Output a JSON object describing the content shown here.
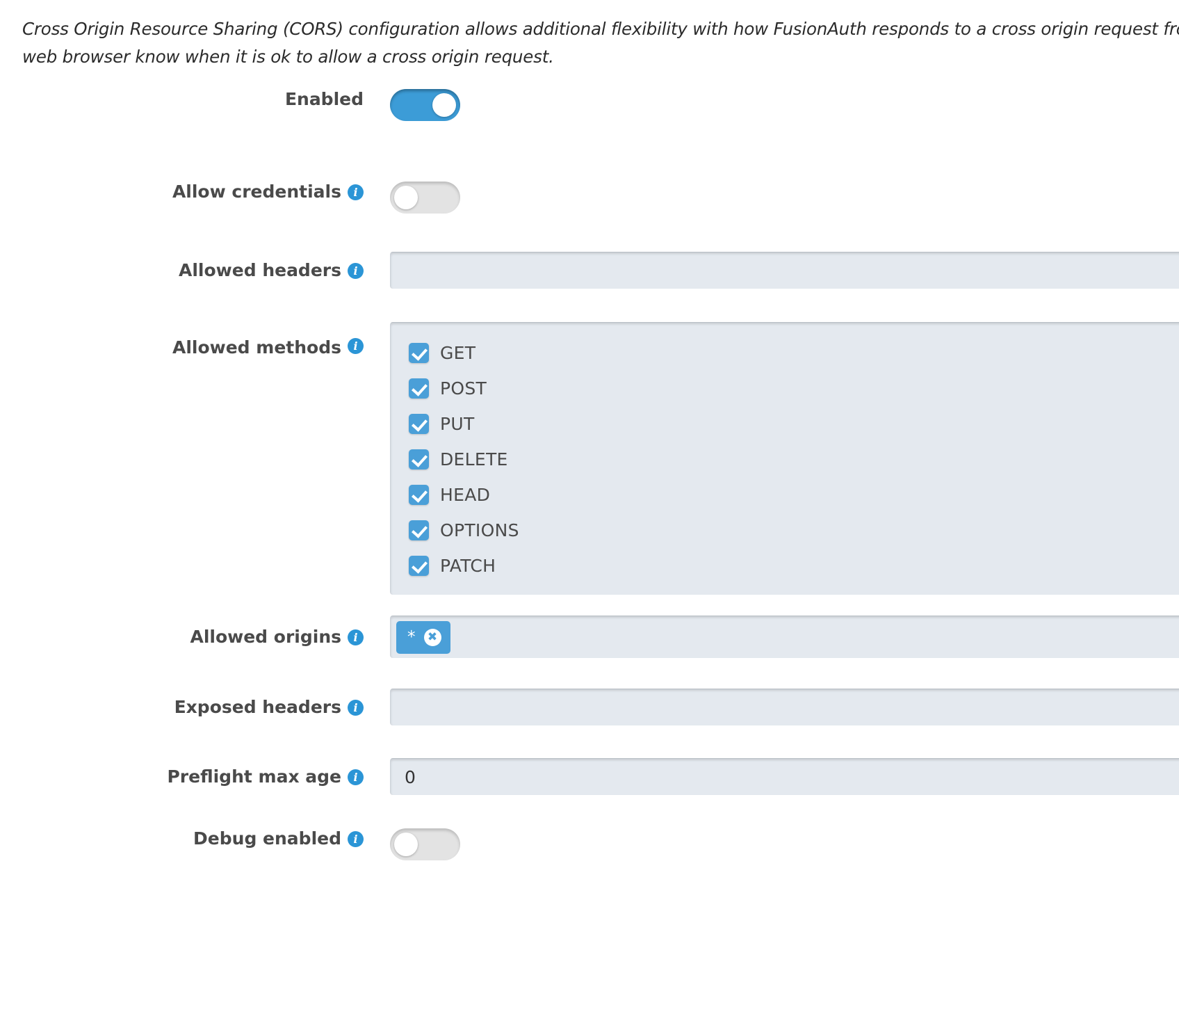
{
  "intro": {
    "line1": "Cross Origin Resource Sharing (CORS) configuration allows additional flexibility with how FusionAuth responds to a cross origin request from Ja",
    "line2": "web browser know when it is ok to allow a cross origin request."
  },
  "colors": {
    "accent_blue": "#3c9cd7",
    "checkbox_blue": "#4a9fd8",
    "info_icon_blue": "#2b95d6",
    "field_bg": "#e4e9ef",
    "label_text": "#4a4a4a",
    "toggle_off": "#e3e3e3"
  },
  "icons": {
    "info": "info-icon",
    "chip_remove": "close-circle-icon",
    "checkmark": "check-icon"
  },
  "fields": {
    "enabled": {
      "label": "Enabled",
      "has_info": false,
      "type": "toggle",
      "state": "on",
      "state_label": "On"
    },
    "allow_credentials": {
      "label": "Allow credentials",
      "has_info": true,
      "type": "toggle",
      "state": "off",
      "state_label": "Off"
    },
    "allowed_headers": {
      "label": "Allowed headers",
      "has_info": true,
      "type": "text",
      "value": "",
      "placeholder": ""
    },
    "allowed_methods": {
      "label": "Allowed methods",
      "has_info": true,
      "type": "checkbox-group",
      "options": [
        {
          "label": "GET",
          "checked": true
        },
        {
          "label": "POST",
          "checked": true
        },
        {
          "label": "PUT",
          "checked": true
        },
        {
          "label": "DELETE",
          "checked": true
        },
        {
          "label": "HEAD",
          "checked": true
        },
        {
          "label": "OPTIONS",
          "checked": true
        },
        {
          "label": "PATCH",
          "checked": true
        }
      ]
    },
    "allowed_origins": {
      "label": "Allowed origins",
      "has_info": true,
      "type": "chips",
      "chips": [
        {
          "value": "*",
          "remove_label": "✖"
        }
      ]
    },
    "exposed_headers": {
      "label": "Exposed headers",
      "has_info": true,
      "type": "text",
      "value": "",
      "placeholder": ""
    },
    "preflight_max_age": {
      "label": "Preflight max age",
      "has_info": true,
      "type": "text",
      "value": "0",
      "placeholder": ""
    },
    "debug_enabled": {
      "label": "Debug enabled",
      "has_info": true,
      "type": "toggle",
      "state": "off",
      "state_label": "Off"
    }
  }
}
